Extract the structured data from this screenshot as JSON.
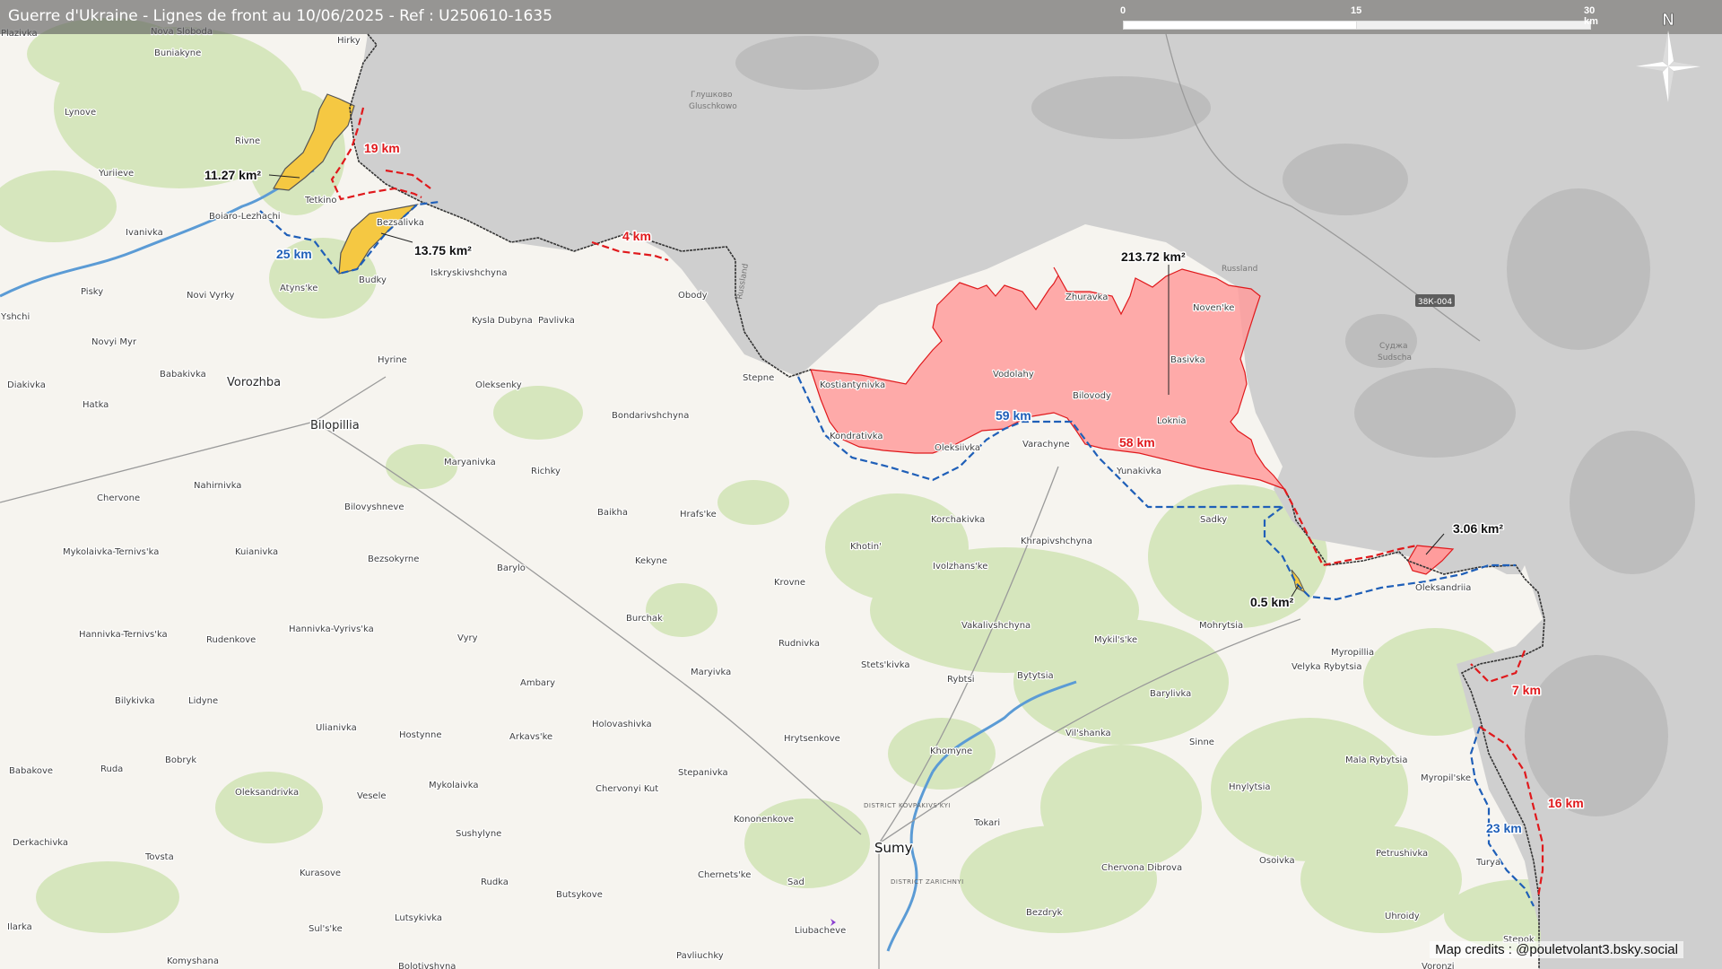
{
  "title": "Guerre d'Ukraine - Lignes de front au 10/06/2025 - Ref : U250610-1635",
  "scale": {
    "labels": [
      "0",
      "15",
      "30 km"
    ]
  },
  "north_icon": "compass-rose-icon",
  "credits": "Map credits : @pouletvolant3.bsky.social",
  "colors": {
    "russian_territory": "#c9c9c9",
    "ukrainian_land": "#f6f4ef",
    "forest": "#d6e6bd",
    "russian_advance": "#ff9c9c",
    "russian_advance_border": "#e0191c",
    "claimed_area": "#f5c842",
    "ukrainian_line": "#1f5fb8",
    "border": "#333333",
    "river": "#5b9bd5"
  },
  "area_labels": {
    "a1": "11.27 km²",
    "a2": "13.75 km²",
    "a3": "213.72 km²",
    "a4": "3.06 km²",
    "a5": "0.5 km²"
  },
  "distance_labels": {
    "d1": "19 km",
    "d2": "25 km",
    "d3": "4 km",
    "d4": "59 km",
    "d5": "58 km",
    "d6": "7 km",
    "d7": "16 km",
    "d8": "23 km"
  },
  "major_places": {
    "sumy": "Sumy",
    "bilopillia": "Bilopillia",
    "vorozhba": "Vorozhba"
  },
  "russian_places": {
    "glushkovo": "Глушково",
    "glushkovo_lat": "Gluschkowo",
    "sudzha": "Суджа",
    "sudzha_lat": "Sudscha",
    "road": "38К-004",
    "russland1": "Russland",
    "russland2": "Russland",
    "hirky": "Hirky"
  },
  "districts": {
    "kovpak": "DISTRICT KOVPAKIVS'KYI",
    "zarich": "DISTRICT ZARICHNYI"
  },
  "places": {
    "p1": "Nova Sloboda",
    "p2": "Buniakyne",
    "p3": "Lynove",
    "p4": "Rivne",
    "p5": "Yuriieve",
    "p6": "Tetkino",
    "p7": "Boiaro-Lezhachi",
    "p8": "Ivanivka",
    "p9": "Bezsalivka",
    "p10": "Iskryskivshchyna",
    "p11": "Budky",
    "p12": "Atyns'ke",
    "p13": "Pisky",
    "p14": "Novi Vyrky",
    "p15": "Obody",
    "p16": "Kysla Dubyna",
    "p17": "Pavlivka",
    "p18": "Novyi Myr",
    "p19": "Babakivka",
    "p20": "Hyrine",
    "p21": "Oleksenky",
    "p22": "Stepne",
    "p23": "Diakivka",
    "p24": "Hatka",
    "p25": "Bondarivshchyna",
    "p26": "Kostiantynivka",
    "p27": "Vodolahy",
    "p28": "Zhuravka",
    "p29": "Noven'ke",
    "p30": "Basivka",
    "p31": "Bilovody",
    "p32": "Loknia",
    "p33": "Kondrativka",
    "p34": "Oleksiivka",
    "p35": "Varachyne",
    "p36": "Yunakivka",
    "p37": "Maryanivka",
    "p38": "Richky",
    "p39": "Nahirnivka",
    "p40": "Chervone",
    "p41": "Bilovyshneve",
    "p42": "Baikha",
    "p43": "Hrafs'ke",
    "p44": "Korchakivka",
    "p45": "Sadky",
    "p46": "Khrapivshchyna",
    "p47": "Khotin'",
    "p48": "Mykolaivka-Ternivs'ka",
    "p49": "Kuianivka",
    "p50": "Bezsokyrne",
    "p51": "Barylo",
    "p52": "Kekyne",
    "p53": "Ivolzhans'ke",
    "p54": "Krovne",
    "p55": "Oleksandriia",
    "p56": "Burchak",
    "p57": "Vakalivshchyna",
    "p58": "Mykil's'ke",
    "p59": "Mohrytsia",
    "p60": "Myropillia",
    "p61": "Hannivka-Ternivs'ka",
    "p62": "Rudenkove",
    "p63": "Hannivka-Vyrivs'ka",
    "p64": "Vyry",
    "p65": "Rudnivka",
    "p66": "Stets'kivka",
    "p67": "Rybtsi",
    "p68": "Bytytsia",
    "p69": "Barylivka",
    "p70": "Velyka Rybytsia",
    "p71": "Maryivka",
    "p72": "Ambary",
    "p73": "Bilykivka",
    "p74": "Lidyne",
    "p75": "Ulianivka",
    "p76": "Hostynne",
    "p77": "Holovashivka",
    "p78": "Arkavs'ke",
    "p79": "Hrytsenkove",
    "p80": "Khomyne",
    "p81": "Vil'shanka",
    "p82": "Sinne",
    "p83": "Mala Rybytsia",
    "p84": "Myropil'ske",
    "p85": "Babakove",
    "p86": "Ruda",
    "p87": "Bobryk",
    "p88": "Stepanivka",
    "p89": "Oleksandrivka",
    "p90": "Mykolaivka",
    "p91": "Vesele",
    "p92": "Chervonyi Kut",
    "p93": "Hnylytsia",
    "p94": "Kononenkove",
    "p95": "Tokari",
    "p96": "Derkachivka",
    "p97": "Sushylyne",
    "p98": "Tovsta",
    "p99": "Petrushivka",
    "p100": "Kurasove",
    "p101": "Chernets'ke",
    "p102": "Sad",
    "p103": "Osoivka",
    "p104": "Turya",
    "p105": "Chervona Dibrova",
    "p106": "Rudka",
    "p107": "Butsykove",
    "p108": "Bezdryk",
    "p109": "Uhroidy",
    "p110": "Lutsykivka",
    "p111": "Sul's'ke",
    "p112": "Liubacheve",
    "p113": "Stepok",
    "p114": "Pavliuchky",
    "p115": "Komyshana",
    "p116": "Voronzi",
    "p117": "Bolotivshyna",
    "p118": "Plazivka",
    "p119": "Ilarka",
    "p120": "Yshchi"
  }
}
